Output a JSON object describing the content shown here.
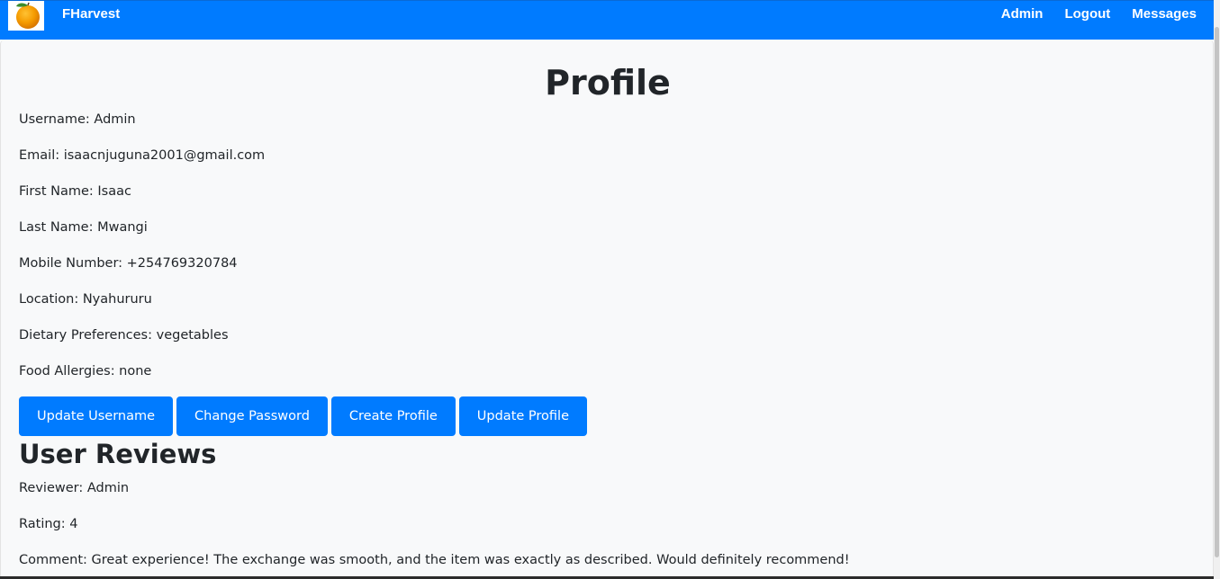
{
  "navbar": {
    "brand": "FHarvest",
    "links": [
      "Admin",
      "Logout",
      "Messages"
    ],
    "bg_color": "#007bff"
  },
  "profile": {
    "title": "Profile",
    "fields": [
      "Username: Admin",
      "Email: isaacnjuguna2001@gmail.com",
      "First Name: Isaac",
      "Last Name: Mwangi",
      "Mobile Number: +254769320784",
      "Location: Nyahururu",
      "Dietary Preferences: vegetables",
      "Food Allergies: none"
    ],
    "buttons": [
      "Update Username",
      "Change Password",
      "Create Profile",
      "Update Profile"
    ]
  },
  "reviews": {
    "title": "User Reviews",
    "items": [
      {
        "reviewer": "Reviewer: Admin",
        "rating": "Rating: 4",
        "comment": "Comment: Great experience! The exchange was smooth, and the item was exactly as described. Would definitely recommend!"
      }
    ]
  },
  "icons": {
    "logo": "orange-fruit-icon"
  }
}
